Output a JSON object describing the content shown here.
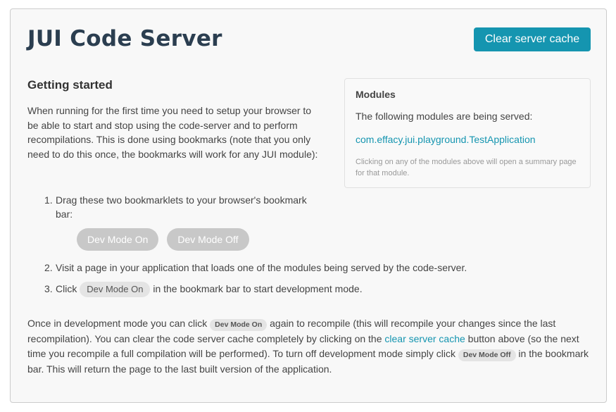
{
  "header": {
    "title": "JUI Code Server",
    "clear_button": "Clear server cache"
  },
  "getting_started": {
    "title": "Getting started",
    "intro": "When running for the first time you need to setup your browser to be able to start and stop using the code-server and to perform recompilations. This is done using bookmarks (note that you only need to do this once, the bookmarks will work for any JUI module):",
    "steps": [
      {
        "num": "1.",
        "text": "Drag these two bookmarklets to your browser's bookmark bar:"
      },
      {
        "num": "2.",
        "text": "Visit a page in your application that loads one of the modules being served by the code-server."
      },
      {
        "num": "3.",
        "before": "Click",
        "after": "in the bookmark bar to start development mode."
      }
    ],
    "bookmarklets": {
      "on": "Dev Mode On",
      "off": "Dev Mode Off"
    },
    "outro": {
      "part1": "Once in development mode you can click",
      "part2": "again to recompile (this will recompile your changes since the last recompilation). You can clear the code server cache completely by clicking on the",
      "link": "clear server cache",
      "part3": "button above (so the next time you recompile a full compilation will be performed). To turn off development mode simply click",
      "part4": "in the bookmark bar. This will return the page to the last built version of the application."
    }
  },
  "modules": {
    "title": "Modules",
    "text": "The following modules are being served:",
    "items": [
      "com.effacy.jui.playground.TestApplication"
    ],
    "note": "Clicking on any of the modules above will open a summary page for that module."
  },
  "colors": {
    "accent": "#1595b0",
    "title": "#2b3e50",
    "bookmarklet_bg": "#c8c8c8"
  }
}
